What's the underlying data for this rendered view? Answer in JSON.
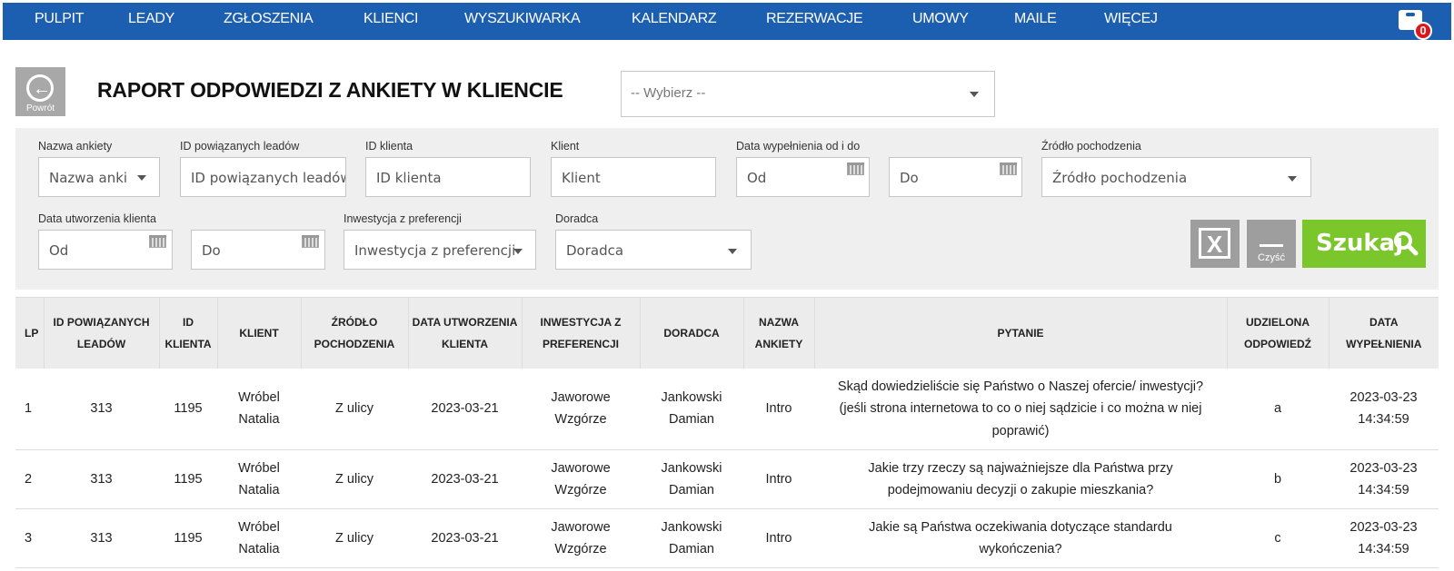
{
  "nav": {
    "items": [
      "PULPIT",
      "LEADY",
      "ZGŁOSZENIA",
      "KLIENCI",
      "WYSZUKIWARKA",
      "KALENDARZ",
      "REZERWACJE",
      "UMOWY",
      "MAILE",
      "WIĘCEJ"
    ],
    "cart_icon": "inbox-icon",
    "cart_count": "0"
  },
  "header": {
    "back_label": "Powrót",
    "title": "RAPORT ODPOWIEDZI Z ANKIETY W KLIENCIE",
    "survey_select": "-- Wybierz --"
  },
  "filters": {
    "survey_name": {
      "label": "Nazwa ankiety",
      "placeholder": "Nazwa anki"
    },
    "lead_ids": {
      "label": "ID powiązanych leadów",
      "placeholder": "ID powiązanych leadów"
    },
    "client_id": {
      "label": "ID klienta",
      "placeholder": "ID klienta"
    },
    "client": {
      "label": "Klient",
      "placeholder": "Klient"
    },
    "fill_date": {
      "label": "Data wypełnienia od i do",
      "from": "Od",
      "to": "Do"
    },
    "source": {
      "label": "Źródło pochodzenia",
      "placeholder": "Źródło pochodzenia"
    },
    "created_date": {
      "label": "Data utworzenia klienta",
      "from": "Od",
      "to": "Do"
    },
    "investment": {
      "label": "Inwestycja z preferencji",
      "placeholder": "Inwestycja z preferencji"
    },
    "advisor": {
      "label": "Doradca",
      "placeholder": "Doradca"
    },
    "export_icon": "excel-icon",
    "clear_label": "Czyść",
    "search_label": "Szukaj"
  },
  "table": {
    "headers": {
      "lp": "LP",
      "lead_ids_1": "ID POWIĄZANYCH",
      "lead_ids_2": "LEADÓW",
      "client_id_1": "ID",
      "client_id_2": "KLIENTA",
      "client": "KLIENT",
      "source_1": "ŹRÓDŁO",
      "source_2": "POCHODZENIA",
      "created_1": "DATA UTWORZENIA",
      "created_2": "KLIENTA",
      "investment_1": "INWESTYCJA Z",
      "investment_2": "PREFERENCJI",
      "advisor": "DORADCA",
      "survey_1": "NAZWA",
      "survey_2": "ANKIETY",
      "question": "PYTANIE",
      "answer_1": "UDZIELONA",
      "answer_2": "ODPOWIEDŹ",
      "filled_1": "DATA",
      "filled_2": "WYPEŁNIENIA"
    },
    "rows": [
      {
        "lp": "1",
        "lead_ids": "313",
        "client_id": "1195",
        "client_1": "Wróbel",
        "client_2": "Natalia",
        "source": "Z ulicy",
        "created": "2023-03-21",
        "investment_1": "Jaworowe",
        "investment_2": "Wzgórze",
        "advisor_1": "Jankowski",
        "advisor_2": "Damian",
        "survey": "Intro",
        "question_1": "Skąd dowiedzieliście się Państwo o Naszej ofercie/ inwestycji?",
        "question_2": "(jeśli strona internetowa to co o niej sądzicie i co można w niej",
        "question_3": "poprawić)",
        "answer": "a",
        "filled_date": "2023-03-23",
        "filled_time": "14:34:59"
      },
      {
        "lp": "2",
        "lead_ids": "313",
        "client_id": "1195",
        "client_1": "Wróbel",
        "client_2": "Natalia",
        "source": "Z ulicy",
        "created": "2023-03-21",
        "investment_1": "Jaworowe",
        "investment_2": "Wzgórze",
        "advisor_1": "Jankowski",
        "advisor_2": "Damian",
        "survey": "Intro",
        "question_1": "Jakie trzy rzeczy są najważniejsze dla Państwa przy",
        "question_2": "podejmowaniu decyzji o zakupie mieszkania?",
        "answer": "b",
        "filled_date": "2023-03-23",
        "filled_time": "14:34:59"
      },
      {
        "lp": "3",
        "lead_ids": "313",
        "client_id": "1195",
        "client_1": "Wróbel",
        "client_2": "Natalia",
        "source": "Z ulicy",
        "created": "2023-03-21",
        "investment_1": "Jaworowe",
        "investment_2": "Wzgórze",
        "advisor_1": "Jankowski",
        "advisor_2": "Damian",
        "survey": "Intro",
        "question_1": "Jakie są Państwa oczekiwania dotyczące standardu",
        "question_2": "wykończenia?",
        "answer": "c",
        "filled_date": "2023-03-23",
        "filled_time": "14:34:59"
      }
    ]
  }
}
